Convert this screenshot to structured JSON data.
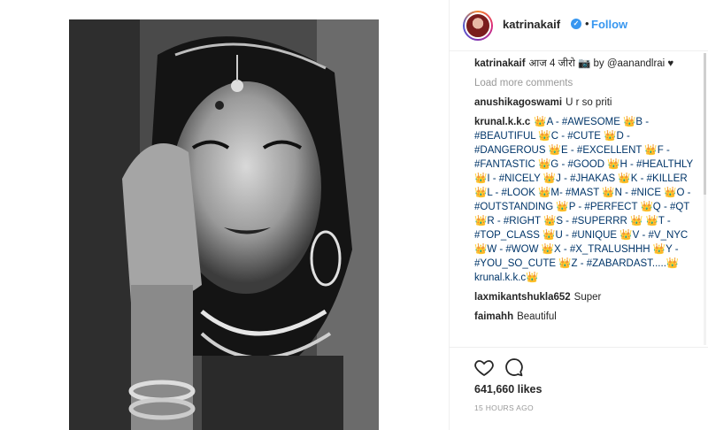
{
  "post": {
    "username": "katrinakaif",
    "verified_icon": "verified-badge-icon",
    "separator": "•",
    "follow_label": "Follow"
  },
  "caption": {
    "username": "katrinakaif",
    "text": "आज 4 जीरो 📷 by @aanandlrai ♥"
  },
  "load_more": "Load more comments",
  "comments": [
    {
      "username": "anushikagoswami",
      "text": "U r so priti"
    },
    {
      "username": "krunal.k.k.c",
      "text": "👑A - #AWESOME 👑B - #BEAUTIFUL 👑C - #CUTE 👑D - #DANGEROUS 👑E - #EXCELLENT 👑F - #FANTASTIC 👑G - #GOOD 👑H - #HEALTHLY 👑I - #NICELY 👑J - #JHAKAS 👑K - #KILLER 👑L - #LOOK 👑M- #MAST 👑N - #NICE 👑O - #OUTSTANDING 👑P - #PERFECT 👑Q - #QT 👑R - #RIGHT 👑S - #SUPERRR 👑 👑T - #TOP_CLASS 👑U - #UNIQUE 👑V - #V_NYC 👑W - #WOW 👑X - #X_TRALUSHHH 👑Y - #YOU_SO_CUTE 👑Z - #ZABARDAST.....👑krunal.k.k.c👑"
    },
    {
      "username": "laxmikantshukla652",
      "text": "Super"
    },
    {
      "username": "faimahh",
      "text": "Beautiful"
    }
  ],
  "actions": {
    "like_icon": "heart-outline-icon",
    "comment_icon": "speech-bubble-icon"
  },
  "likes": "641,660 likes",
  "timestamp": "15 HOURS AGO",
  "colors": {
    "link": "#3897f0",
    "hashtag": "#003569",
    "muted": "#999999",
    "text": "#262626",
    "border": "#efefef"
  }
}
